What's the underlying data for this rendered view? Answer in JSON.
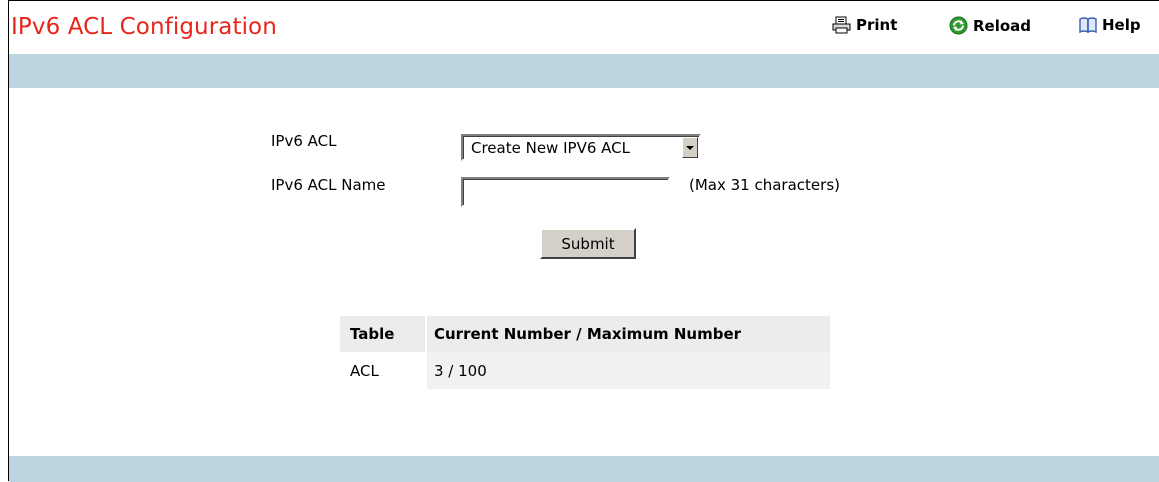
{
  "header": {
    "title": "IPv6 ACL Configuration",
    "tools": {
      "print_label": "Print",
      "reload_label": "Reload",
      "help_label": "Help"
    }
  },
  "form": {
    "acl_label": "IPv6 ACL",
    "acl_select_value": "Create New IPV6 ACL",
    "name_label": "IPv6 ACL Name",
    "name_value": "",
    "name_hint": "(Max 31 characters)",
    "submit_label": "Submit"
  },
  "table": {
    "headers": [
      "Table",
      "Current Number / Maximum Number"
    ],
    "rows": [
      [
        "ACL",
        "3 / 100"
      ]
    ]
  },
  "colors": {
    "title": "#e8251a",
    "band": "#bcd3e0",
    "table_header_bg": "#ececec",
    "reload_icon": "#2e9b2e",
    "help_icon": "#3a5fb0"
  }
}
